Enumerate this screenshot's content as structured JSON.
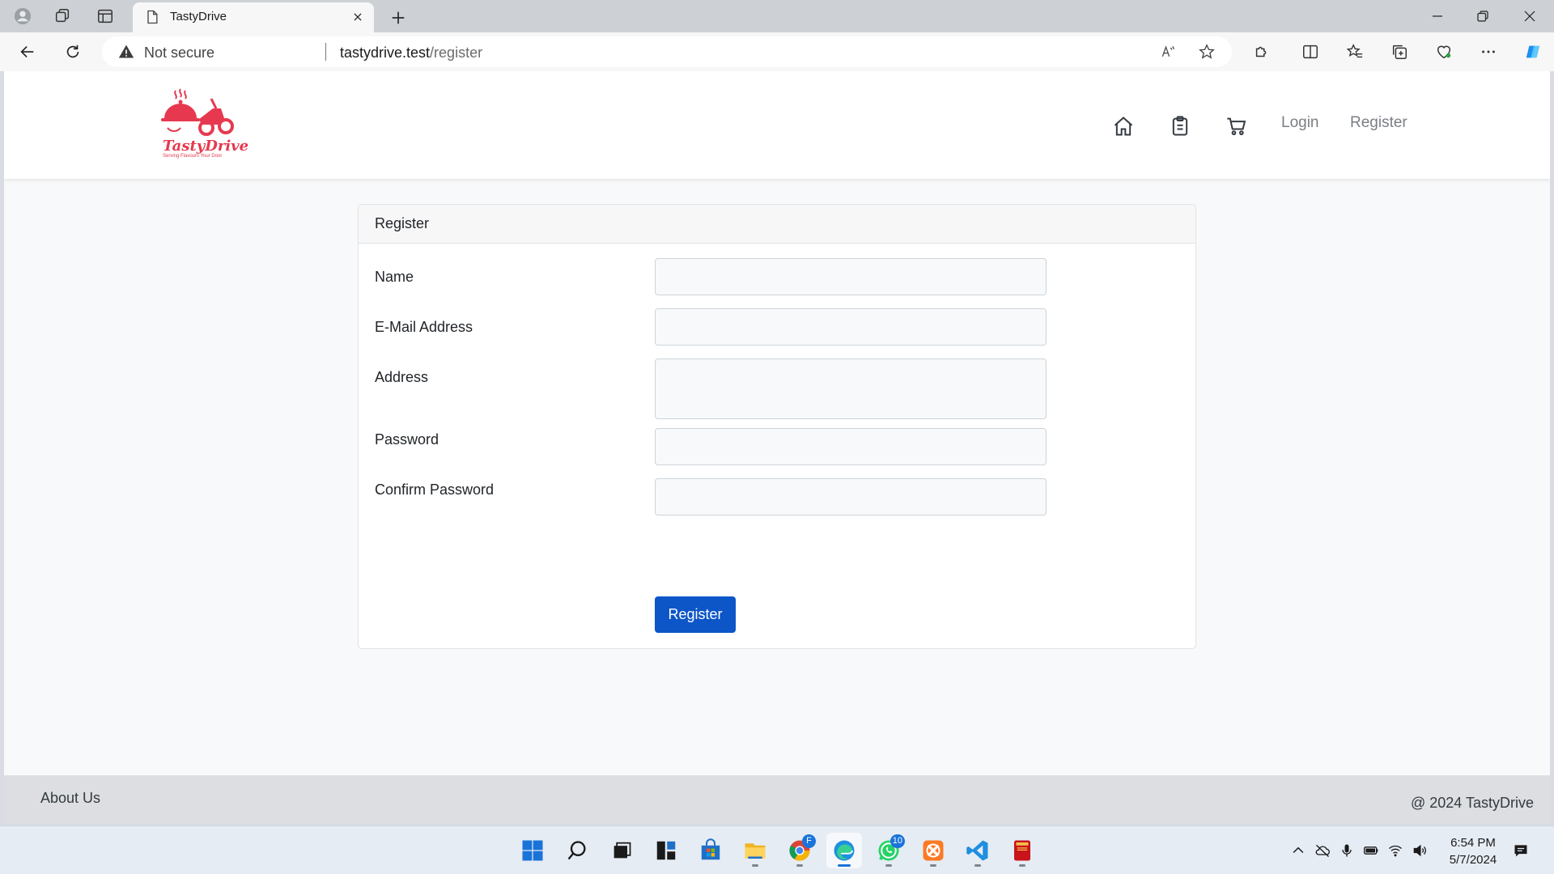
{
  "browser": {
    "tab_title": "TastyDrive",
    "security_label": "Not secure",
    "url_host": "tastydrive.test",
    "url_path": "/register"
  },
  "site": {
    "brand": "TastyDrive",
    "tagline": "Serving Flavours Your Door",
    "nav": {
      "login": "Login",
      "register": "Register"
    },
    "nav_icons": [
      "home-icon",
      "clipboard-icon",
      "cart-icon"
    ]
  },
  "form": {
    "header": "Register",
    "fields": {
      "name": {
        "label": "Name",
        "value": ""
      },
      "email": {
        "label": "E-Mail Address",
        "value": ""
      },
      "address": {
        "label": "Address",
        "value": ""
      },
      "password": {
        "label": "Password",
        "value": ""
      },
      "confirm_password": {
        "label": "Confirm Password",
        "value": ""
      }
    },
    "submit_label": "Register"
  },
  "footer": {
    "about": "About Us",
    "copyright": "@ 2024 TastyDrive"
  },
  "taskbar": {
    "time": "6:54 PM",
    "date": "5/7/2024",
    "whatsapp_badge": "10",
    "chrome_badge": "F"
  },
  "colors": {
    "brand": "#e6394f",
    "primary_button": "#0d56c8"
  }
}
